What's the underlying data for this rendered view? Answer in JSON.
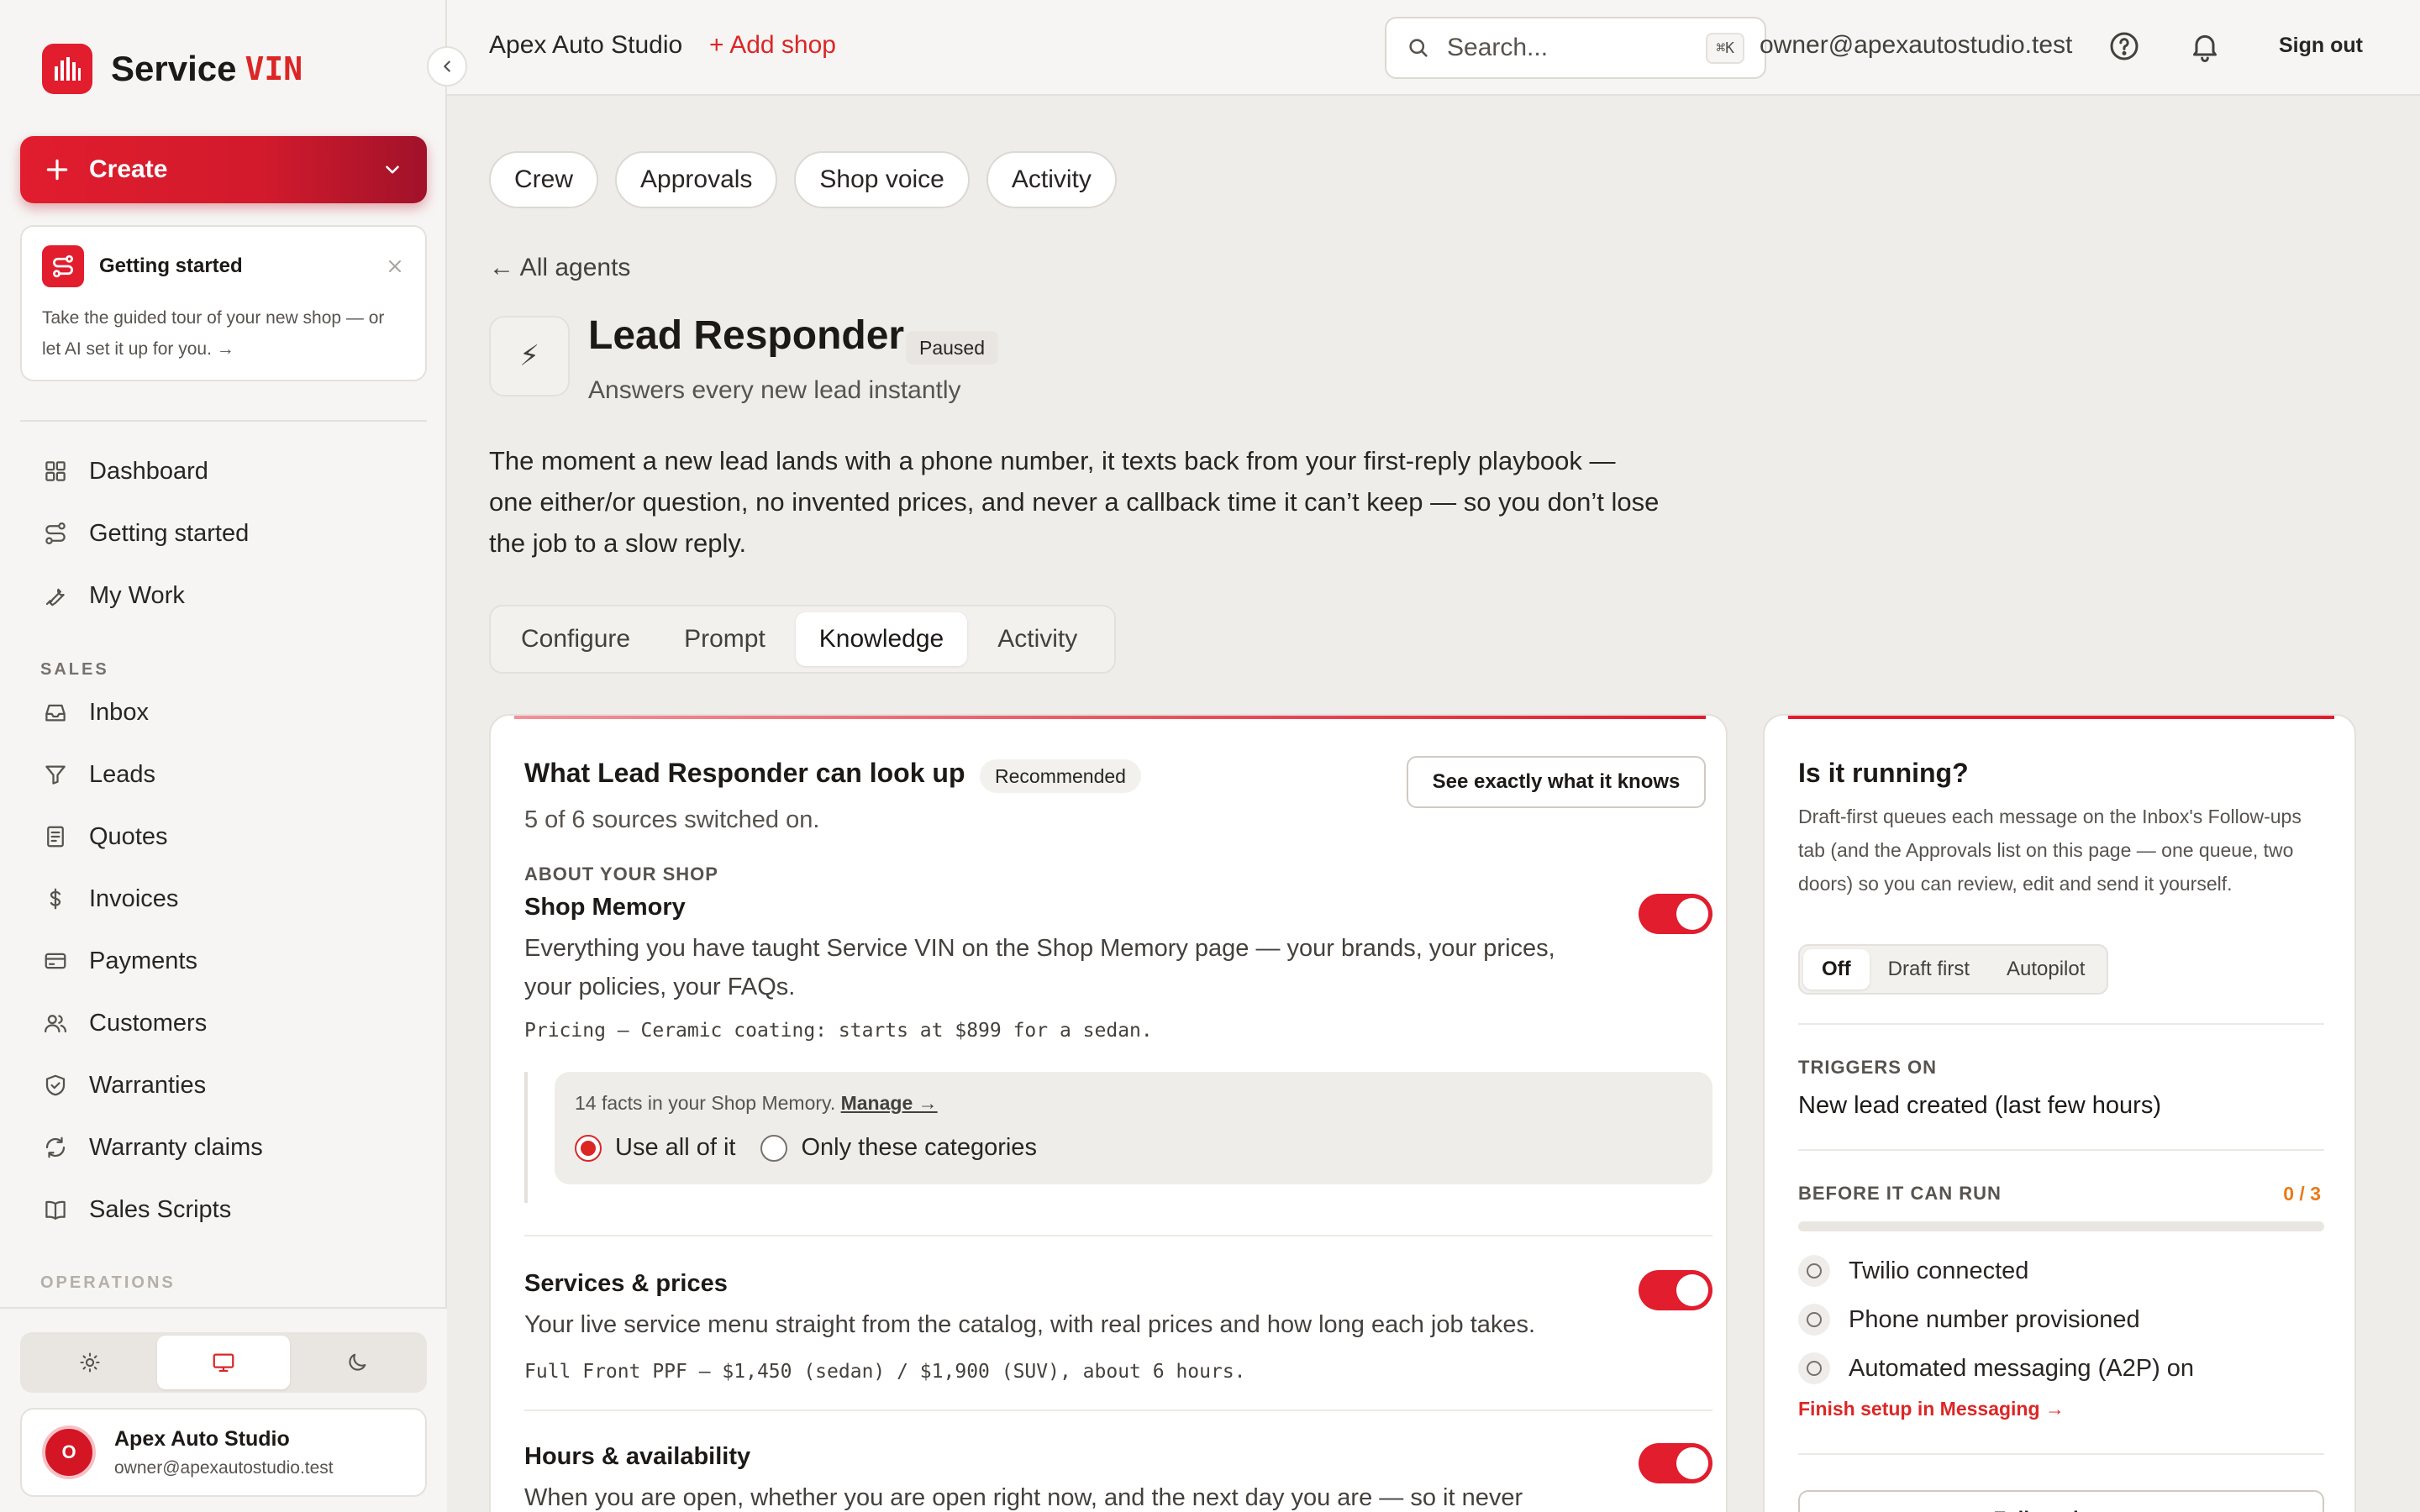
{
  "app": {
    "brand_name": "Service",
    "brand_accent": "VIN",
    "accent_color": "#e11d2e"
  },
  "sidebar": {
    "create_label": "Create",
    "getting_started_card": {
      "title": "Getting started",
      "description": "Take the guided tour of your new shop — or let AI set it up for you. →"
    },
    "nav_main": [
      {
        "label": "Dashboard",
        "icon": "grid-icon"
      },
      {
        "label": "Getting started",
        "icon": "route-icon"
      },
      {
        "label": "My Work",
        "icon": "wrench-icon"
      }
    ],
    "sections": {
      "sales": "SALES",
      "operations": "OPERATIONS"
    },
    "nav_sales": [
      {
        "label": "Inbox",
        "icon": "inbox-icon"
      },
      {
        "label": "Leads",
        "icon": "filter-icon"
      },
      {
        "label": "Quotes",
        "icon": "document-icon"
      },
      {
        "label": "Invoices",
        "icon": "dollar-icon"
      },
      {
        "label": "Payments",
        "icon": "credit-card-icon"
      },
      {
        "label": "Customers",
        "icon": "users-icon"
      },
      {
        "label": "Warranties",
        "icon": "shield-check-icon"
      },
      {
        "label": "Warranty claims",
        "icon": "refresh-icon"
      },
      {
        "label": "Sales Scripts",
        "icon": "book-icon"
      }
    ],
    "theme_options": [
      "light",
      "system",
      "dark"
    ],
    "theme_selected": "system",
    "user": {
      "initial": "O",
      "name": "Apex Auto Studio",
      "email": "owner@apexautostudio.test"
    }
  },
  "topbar": {
    "shop_name": "Apex Auto Studio",
    "add_shop": "+ Add shop",
    "search_placeholder": "Search...",
    "search_shortcut": "⌘K",
    "email": "owner@apexautostudio.test",
    "sign_out": "Sign out"
  },
  "main": {
    "pills": [
      "Crew",
      "Approvals",
      "Shop voice",
      "Activity"
    ],
    "back_link": "← All agents",
    "agent": {
      "icon_glyph": "⚡",
      "title": "Lead Responder",
      "status": "Paused",
      "subtitle": "Answers every new lead instantly",
      "description": "The moment a new lead lands with a phone number, it texts back from your first-reply playbook — one either/or question, no invented prices, and never a callback time it can’t keep — so you don’t lose the job to a slow reply."
    },
    "tabs": [
      "Configure",
      "Prompt",
      "Knowledge",
      "Activity"
    ],
    "active_tab": "Knowledge",
    "knowledge": {
      "title": "What Lead Responder can look up",
      "badge": "Recommended",
      "see_button": "See exactly what it knows",
      "summary": "5 of 6 sources switched on.",
      "section_label": "ABOUT YOUR SHOP",
      "sources": [
        {
          "title": "Shop Memory",
          "description": "Everything you have taught Service VIN on the Shop Memory page — your brands, your prices, your policies, your FAQs.",
          "example": "Pricing — Ceramic coating: starts at $899 for a sedan.",
          "enabled": true
        },
        {
          "title": "Services & prices",
          "description": "Your live service menu straight from the catalog, with real prices and how long each job takes.",
          "example": "Full Front PPF — $1,450 (sedan) / $1,900 (SUV), about 6 hours.",
          "enabled": true
        },
        {
          "title": "Hours & availability",
          "description": "When you are open, whether you are open right now, and the next day you are — so it never promises a time you are shut.",
          "enabled": true
        }
      ],
      "memory_box": {
        "info": "14 facts in your Shop Memory.",
        "manage_link": "Manage →",
        "options": [
          "Use all of it",
          "Only these categories"
        ],
        "selected": "Use all of it"
      }
    },
    "running": {
      "title": "Is it running?",
      "description": "Draft-first queues each message on the Inbox's Follow-ups tab (and the Approvals list on this page — one queue, two doors) so you can review, edit and send it yourself.",
      "modes": [
        "Off",
        "Draft first",
        "Autopilot"
      ],
      "selected_mode": "Off",
      "triggers_label": "TRIGGERS ON",
      "trigger": "New lead created (last few hours)",
      "before_label": "BEFORE IT CAN RUN",
      "progress_text": "0 / 3",
      "progress_fraction": 0,
      "checks": [
        "Twilio connected",
        "Phone number provisioned",
        "Automated messaging (A2P) on"
      ],
      "finish_link": "Finish setup in Messaging →",
      "run_log_button": "Full run log →"
    }
  }
}
